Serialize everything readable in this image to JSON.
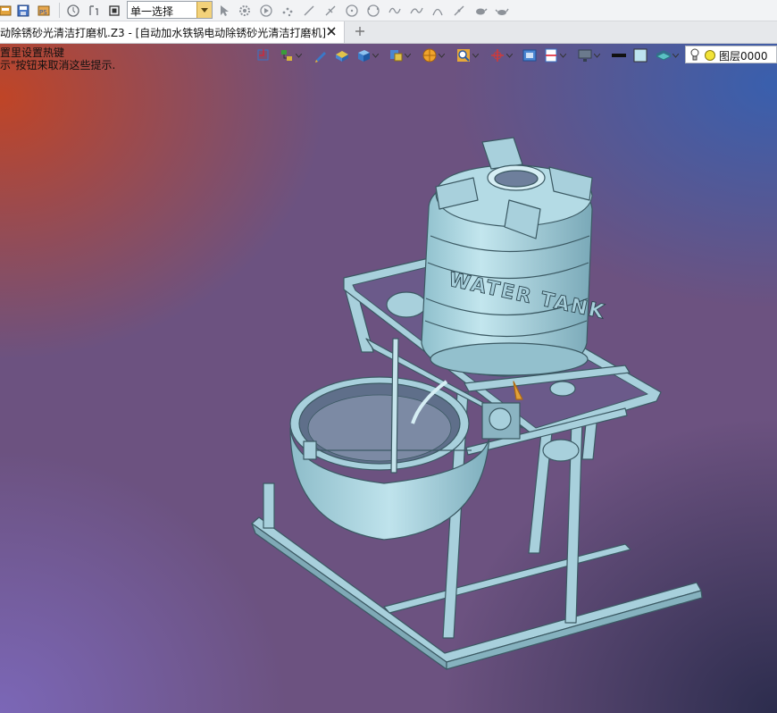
{
  "toolbar": {
    "select_mode": "单一选择",
    "icons": [
      "app-icon",
      "save-icon",
      "export-icon",
      "rotate-icon",
      "step-icon",
      "stop-icon",
      "cursor-icon",
      "gear-select-icon",
      "play-icon",
      "points-icon",
      "line-icon",
      "trim-icon",
      "circle-icon",
      "arc-icon",
      "sine-icon",
      "curve-icon",
      "spline-icon",
      "smooth-icon",
      "teapot-icon"
    ]
  },
  "tab": {
    "title": "动除锈砂光清洁打磨机.Z3 - [自动加水铁锅电动除锈砂光清洁打磨机]"
  },
  "viewport": {
    "hint_lines": [
      "置里设置热键",
      "示\"按钮来取消这些提示."
    ],
    "layer_name": "图层0000",
    "tank_label": "WATER TANK",
    "view_icons": [
      "cursor-arrow-icon",
      "tree-icon",
      "pen-icon",
      "shaded-box-icon",
      "cube-icon",
      "view-cube-icon",
      "sphere-render-icon",
      "zoom-fit-icon",
      "axis-icon",
      "frame-icon",
      "section-icon",
      "monitor-icon",
      "line-color-icon",
      "fill-color-icon",
      "layer-stack-icon"
    ],
    "colors": {
      "model": "#a8d0dc",
      "model_edge": "#3b5963"
    }
  }
}
